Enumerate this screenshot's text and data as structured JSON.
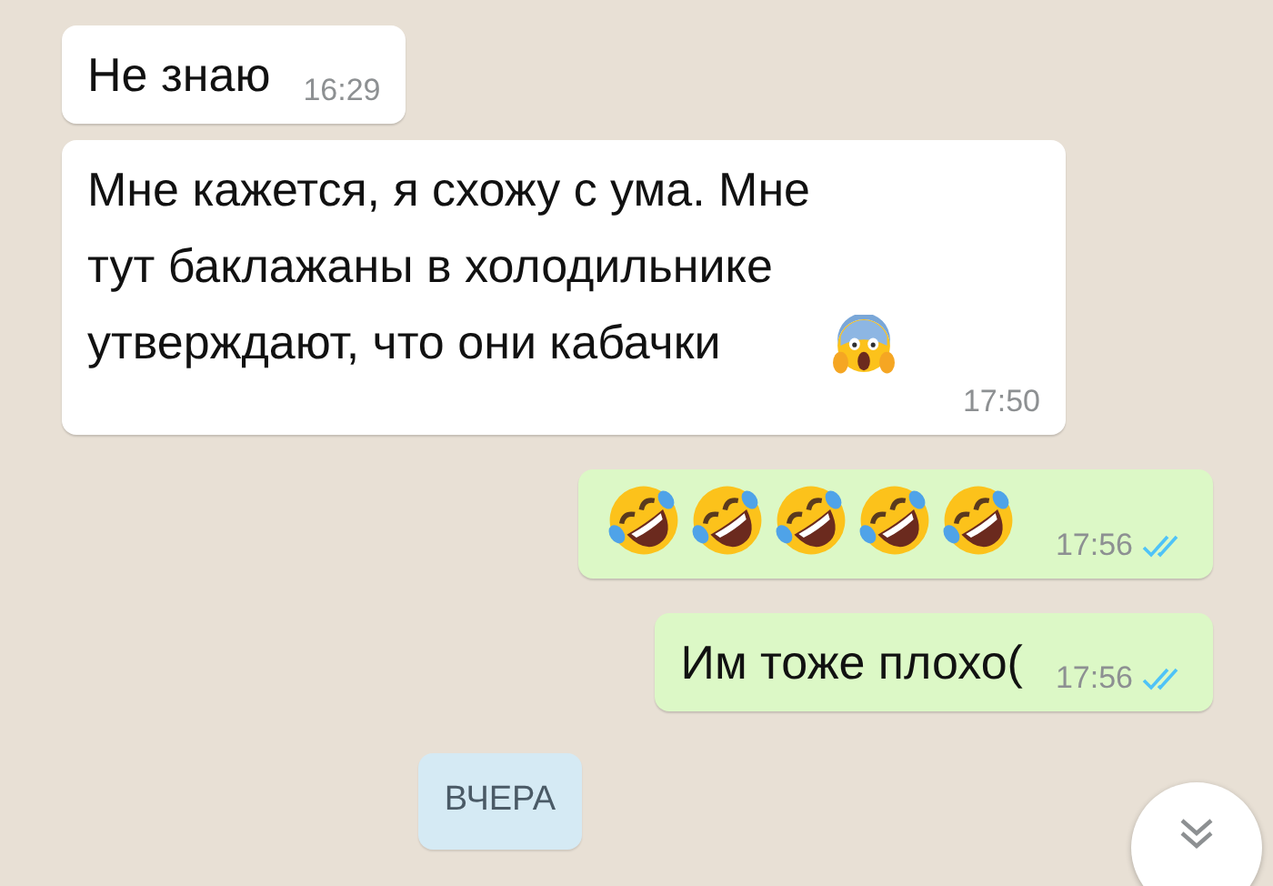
{
  "messages": [
    {
      "kind": "incoming",
      "text": "Не знаю",
      "time": "16:29"
    },
    {
      "kind": "incoming",
      "text": "Мне кажется, я схожу с ума. Мне тут баклажаны в холодильнике утверждают, что они кабачки",
      "emojis": [
        {
          "kind": "scream"
        }
      ],
      "time": "17:50"
    },
    {
      "kind": "outgoing",
      "emojis": [
        {
          "kind": "rofl"
        },
        {
          "kind": "rofl"
        },
        {
          "kind": "rofl"
        },
        {
          "kind": "rofl"
        },
        {
          "kind": "rofl"
        }
      ],
      "time": "17:56",
      "read": true
    },
    {
      "kind": "outgoing",
      "text": "Им тоже плохо(",
      "time": "17:56",
      "read": true
    }
  ],
  "date_chip": "ВЧЕРА"
}
